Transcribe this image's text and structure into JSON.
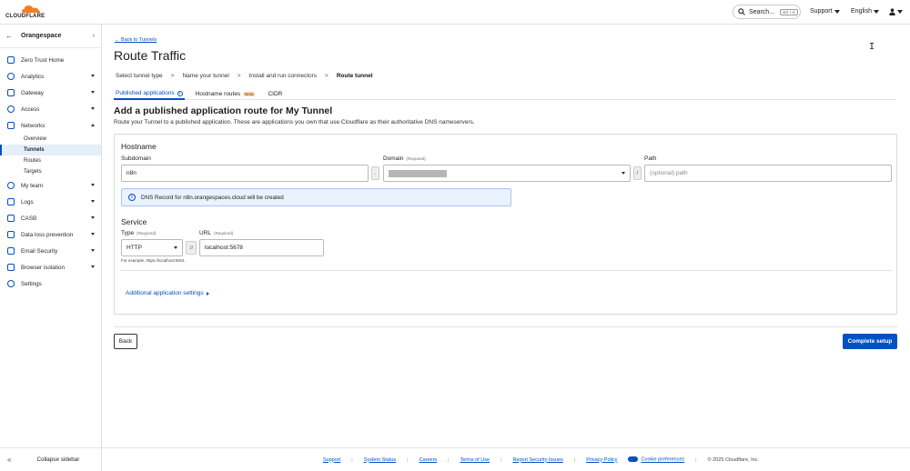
{
  "topbar": {
    "logo_text": "CLOUDFLARE",
    "search_label": "Search...",
    "search_shortcut": "ctrl + K",
    "support": "Support",
    "language": "English"
  },
  "sidebar": {
    "account_name": "Orangespace",
    "items": [
      {
        "label": "Zero Trust Home"
      },
      {
        "label": "Analytics"
      },
      {
        "label": "Gateway"
      },
      {
        "label": "Access"
      },
      {
        "label": "Networks"
      },
      {
        "label": "My team"
      },
      {
        "label": "Logs"
      },
      {
        "label": "CASB"
      },
      {
        "label": "Data loss prevention"
      },
      {
        "label": "Email Security"
      },
      {
        "label": "Browser isolation"
      },
      {
        "label": "Settings"
      }
    ],
    "networks_sub": [
      "Overview",
      "Tunnels",
      "Routes",
      "Targets"
    ],
    "collapse_label": "Collapse sidebar"
  },
  "main": {
    "back_link": "← Back to Tunnels",
    "title": "Route Traffic",
    "steps": [
      "Select tunnel type",
      "Name your tunnel",
      "Install and run connectors",
      "Route tunnel"
    ],
    "step_sep": ">",
    "tabs": {
      "published": "Published applications",
      "hostname": "Hostname routes",
      "beta": "Beta",
      "cidr": "CIDR"
    },
    "section_title": "Add a published application route for My Tunnel",
    "section_desc": "Route your Tunnel to a published application. These are applications you own that use Cloudflare as their authoritative DNS nameservers.",
    "hostname": {
      "group_label": "Hostname",
      "subdomain_label": "Subdomain",
      "subdomain_value": "n8n",
      "dot": ".",
      "domain_label": "Domain",
      "required": "(Required)",
      "slash": "/",
      "path_label": "Path",
      "path_placeholder": "(optional) path",
      "notice": "DNS Record for n8n.orangespaces.cloud will be created"
    },
    "service": {
      "group_label": "Service",
      "type_label": "Type",
      "type_value": "HTTP",
      "scheme_sep": "://",
      "url_label": "URL",
      "url_value": "localhost:5678",
      "hint": "For example, https://localhost:8001"
    },
    "advanced_link": "Additional application settings",
    "back_button": "Back",
    "complete_button": "Complete setup"
  },
  "footer": {
    "links": [
      "Support",
      "System Status",
      "Careers",
      "Terms of Use",
      "Report Security Issues",
      "Privacy Policy"
    ],
    "cookie": "Cookie preferences",
    "copyright": "© 2025 Cloudflare, Inc."
  },
  "colors": {
    "accent": "#0051c3",
    "brand_orange": "#f38020"
  }
}
